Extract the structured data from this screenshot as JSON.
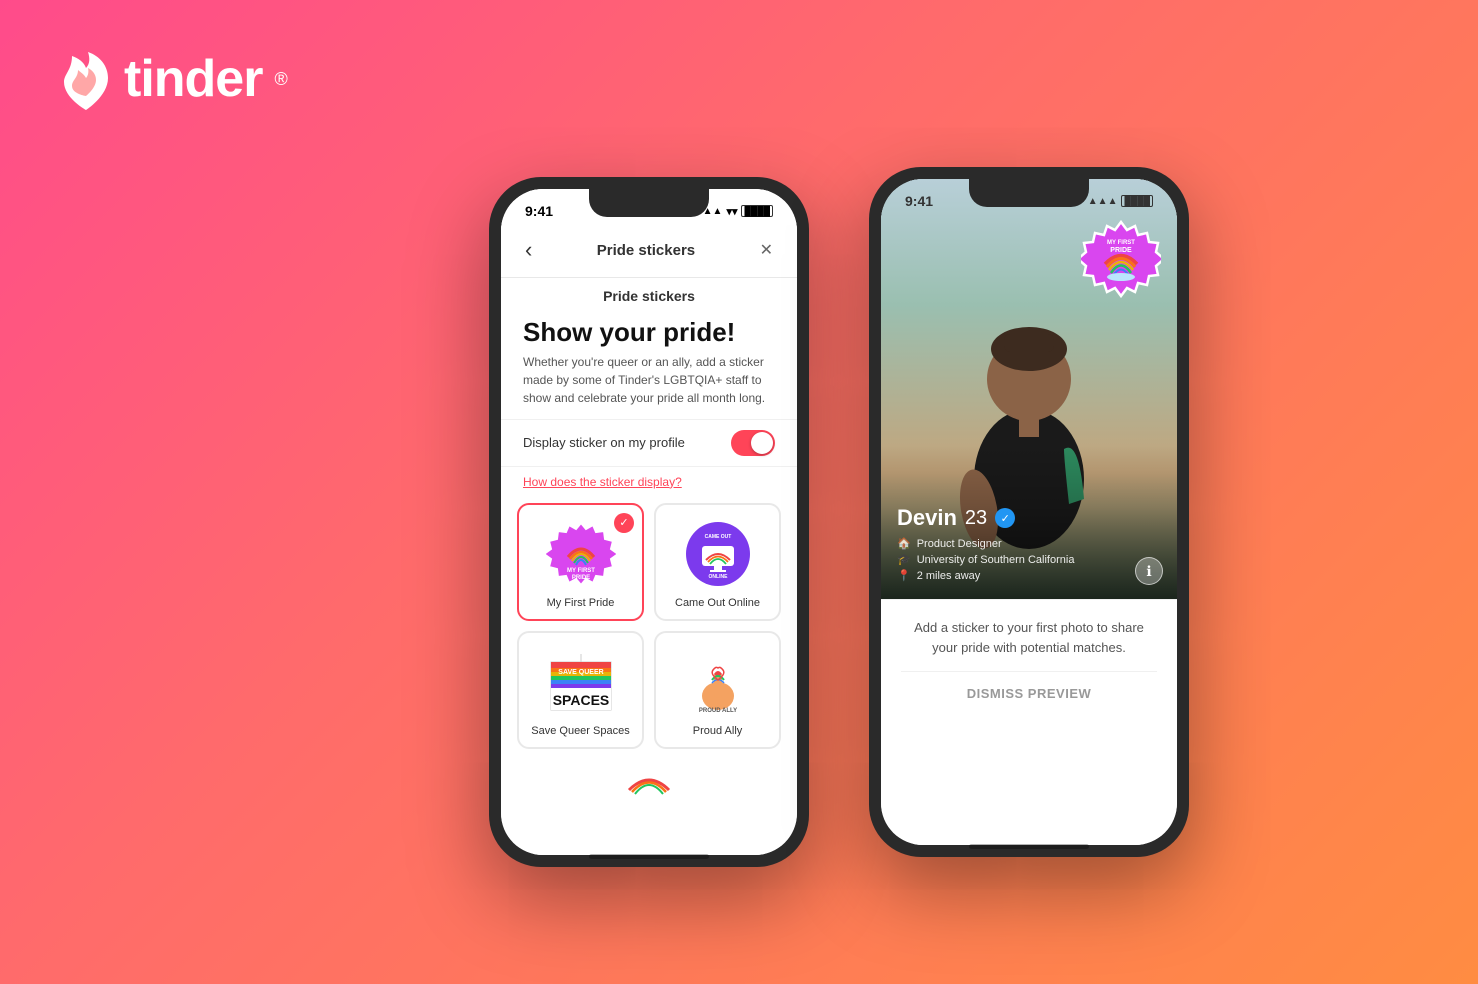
{
  "logo": {
    "brand": "tinder",
    "registered": "®"
  },
  "background": {
    "gradient_start": "#ff4b8b",
    "gradient_end": "#ff8c42"
  },
  "phone_left": {
    "status_bar": {
      "time": "9:41",
      "signal": "▲▲▲",
      "wifi": "WiFi",
      "battery": "🔋"
    },
    "nav": {
      "back_label": "‹",
      "title": "Pride stickers",
      "close_label": "✕"
    },
    "section_title": "Pride stickers",
    "heading": "Show your pride!",
    "description": "Whether you're queer or an ally, add a sticker made by some of Tinder's LGBTQIA+ staff to show and celebrate your pride all month long.",
    "toggle_label": "Display sticker on my profile",
    "toggle_state": true,
    "how_display_link": "How does the sticker display?",
    "stickers": [
      {
        "id": "my-first-pride",
        "label": "My First Pride",
        "selected": true
      },
      {
        "id": "came-out-online",
        "label": "Came Out Online",
        "selected": false
      },
      {
        "id": "save-queer-spaces",
        "label": "Save Queer Spaces",
        "selected": false
      },
      {
        "id": "proud-ally",
        "label": "Proud Ally",
        "selected": false
      }
    ]
  },
  "phone_right": {
    "status_bar": {
      "time": "9:41",
      "signal": "▲▲▲",
      "wifi": "WiFi",
      "battery": "🔋"
    },
    "profile": {
      "name": "Devin",
      "age": "23",
      "verified": true,
      "job": "Product Designer",
      "school": "University of Southern California",
      "distance": "2 miles away"
    },
    "add_sticker_text": "Add a sticker to your first photo to share your pride with potential matches.",
    "dismiss_label": "DISMISS PREVIEW"
  }
}
